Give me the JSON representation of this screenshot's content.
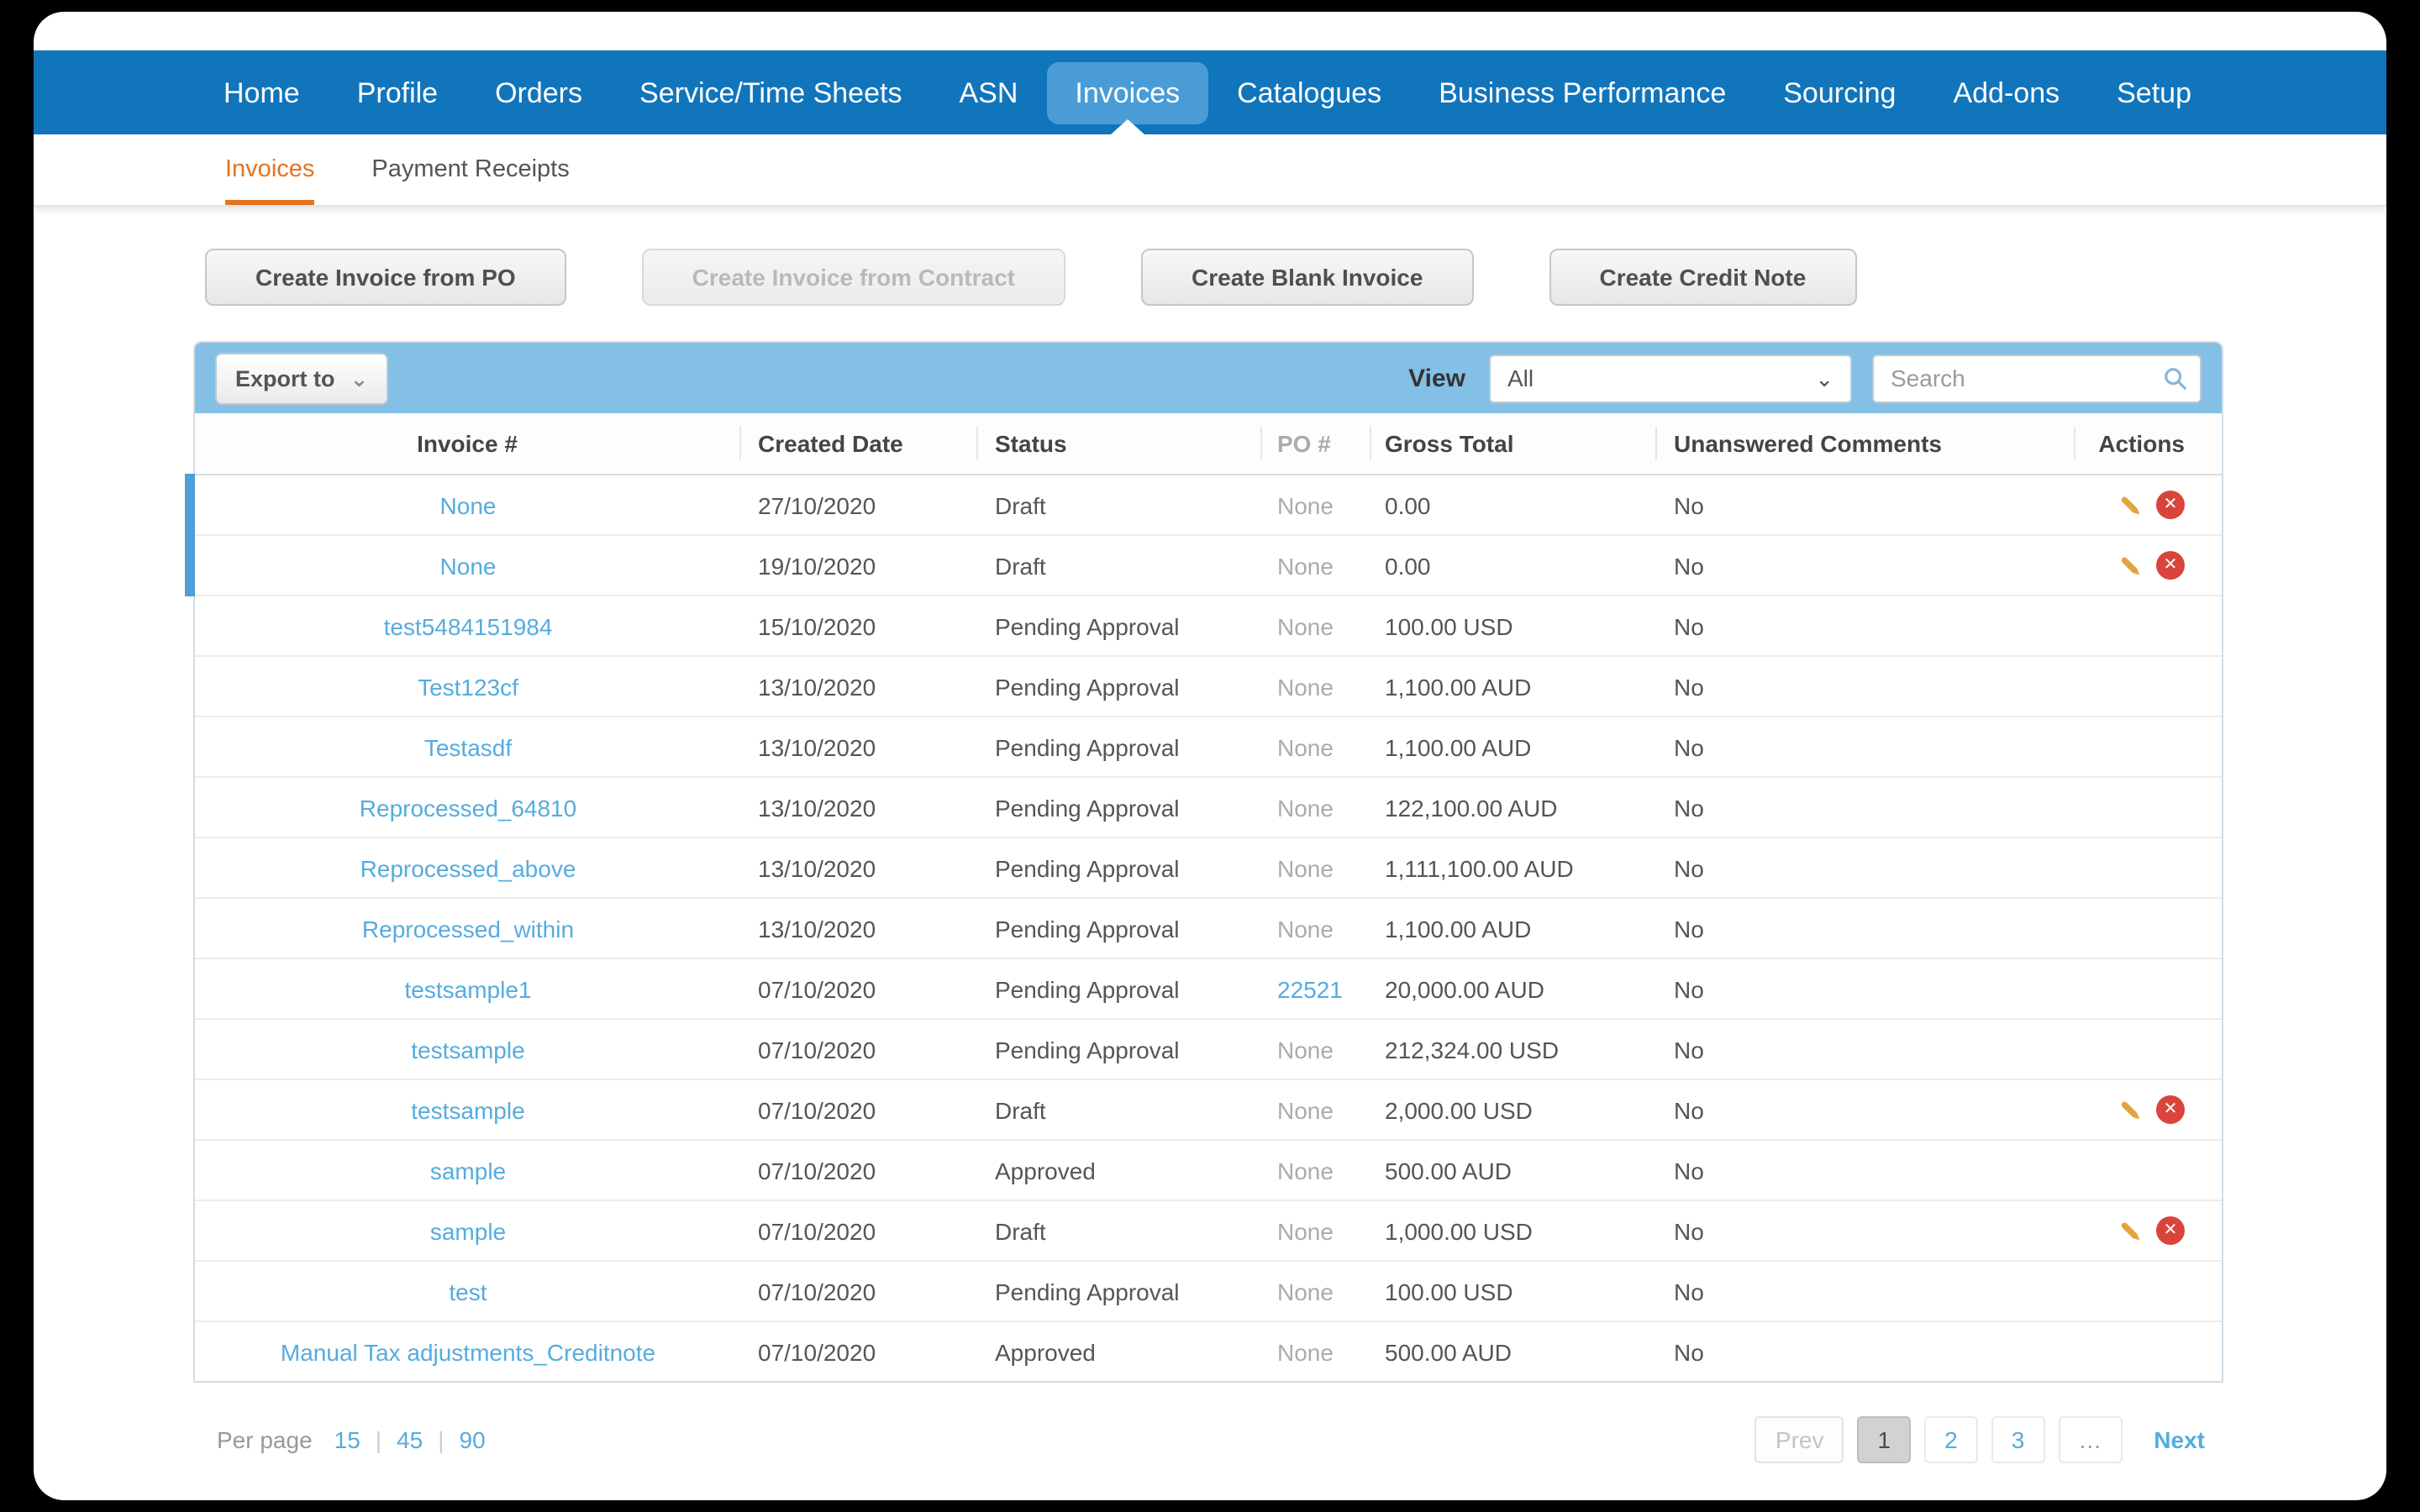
{
  "colors": {
    "nav_blue": "#1175BC",
    "nav_active": "#4A9CD6",
    "orange": "#E5731F",
    "link": "#55ACDE",
    "toolbar_blue": "#84C0E5",
    "accent": "#4D9FD6",
    "red": "#D9443C",
    "pencil": "#E3A43C",
    "text_dark": "#4A4A4A",
    "text_gray": "#ABABAB"
  },
  "icons": {
    "chevron_glyph": "⌄",
    "close_glyph": "✕",
    "search_icon": "magnifier",
    "edit_icon": "pencil",
    "delete_icon": "circle-x",
    "nav_caret": "caret-up"
  },
  "nav": {
    "items": [
      {
        "label": "Home",
        "active": false
      },
      {
        "label": "Profile",
        "active": false
      },
      {
        "label": "Orders",
        "active": false
      },
      {
        "label": "Service/Time Sheets",
        "active": false
      },
      {
        "label": "ASN",
        "active": false
      },
      {
        "label": "Invoices",
        "active": true
      },
      {
        "label": "Catalogues",
        "active": false
      },
      {
        "label": "Business Performance",
        "active": false
      },
      {
        "label": "Sourcing",
        "active": false
      },
      {
        "label": "Add-ons",
        "active": false
      },
      {
        "label": "Setup",
        "active": false
      }
    ]
  },
  "subnav": {
    "items": [
      {
        "label": "Invoices",
        "active": true
      },
      {
        "label": "Payment Receipts",
        "active": false
      }
    ]
  },
  "action_buttons": [
    {
      "label": "Create Invoice from PO",
      "disabled": false
    },
    {
      "label": "Create Invoice from Contract",
      "disabled": true
    },
    {
      "label": "Create Blank Invoice",
      "disabled": false
    },
    {
      "label": "Create Credit Note",
      "disabled": false
    }
  ],
  "toolbar": {
    "export_label": "Export to",
    "view_label": "View",
    "view_value": "All",
    "search_placeholder": "Search"
  },
  "table": {
    "columns": [
      "Invoice #",
      "Created Date",
      "Status",
      "PO #",
      "Gross Total",
      "Unanswered Comments",
      "Actions"
    ],
    "rows": [
      {
        "invoice": "None",
        "created": "27/10/2020",
        "status": "Draft",
        "po": "None",
        "po_is_link": false,
        "gross": "0.00",
        "unanswered_comments": "No",
        "has_actions": true,
        "highlighted": true
      },
      {
        "invoice": "None",
        "created": "19/10/2020",
        "status": "Draft",
        "po": "None",
        "po_is_link": false,
        "gross": "0.00",
        "unanswered_comments": "No",
        "has_actions": true,
        "highlighted": true
      },
      {
        "invoice": "test5484151984",
        "created": "15/10/2020",
        "status": "Pending Approval",
        "po": "None",
        "po_is_link": false,
        "gross": "100.00 USD",
        "unanswered_comments": "No",
        "has_actions": false,
        "highlighted": false
      },
      {
        "invoice": "Test123cf",
        "created": "13/10/2020",
        "status": "Pending Approval",
        "po": "None",
        "po_is_link": false,
        "gross": "1,100.00 AUD",
        "unanswered_comments": "No",
        "has_actions": false,
        "highlighted": false
      },
      {
        "invoice": "Testasdf",
        "created": "13/10/2020",
        "status": "Pending Approval",
        "po": "None",
        "po_is_link": false,
        "gross": "1,100.00 AUD",
        "unanswered_comments": "No",
        "has_actions": false,
        "highlighted": false
      },
      {
        "invoice": "Reprocessed_64810",
        "created": "13/10/2020",
        "status": "Pending Approval",
        "po": "None",
        "po_is_link": false,
        "gross": "122,100.00 AUD",
        "unanswered_comments": "No",
        "has_actions": false,
        "highlighted": false
      },
      {
        "invoice": "Reprocessed_above",
        "created": "13/10/2020",
        "status": "Pending Approval",
        "po": "None",
        "po_is_link": false,
        "gross": "1,111,100.00 AUD",
        "unanswered_comments": "No",
        "has_actions": false,
        "highlighted": false
      },
      {
        "invoice": "Reprocessed_within",
        "created": "13/10/2020",
        "status": "Pending Approval",
        "po": "None",
        "po_is_link": false,
        "gross": "1,100.00 AUD",
        "unanswered_comments": "No",
        "has_actions": false,
        "highlighted": false
      },
      {
        "invoice": "testsample1",
        "created": "07/10/2020",
        "status": "Pending Approval",
        "po": "22521",
        "po_is_link": true,
        "gross": "20,000.00 AUD",
        "unanswered_comments": "No",
        "has_actions": false,
        "highlighted": false
      },
      {
        "invoice": "testsample",
        "created": "07/10/2020",
        "status": "Pending Approval",
        "po": "None",
        "po_is_link": false,
        "gross": "212,324.00 USD",
        "unanswered_comments": "No",
        "has_actions": false,
        "highlighted": false
      },
      {
        "invoice": "testsample",
        "created": "07/10/2020",
        "status": "Draft",
        "po": "None",
        "po_is_link": false,
        "gross": "2,000.00 USD",
        "unanswered_comments": "No",
        "has_actions": true,
        "highlighted": false
      },
      {
        "invoice": "sample",
        "created": "07/10/2020",
        "status": "Approved",
        "po": "None",
        "po_is_link": false,
        "gross": "500.00 AUD",
        "unanswered_comments": "No",
        "has_actions": false,
        "highlighted": false
      },
      {
        "invoice": "sample",
        "created": "07/10/2020",
        "status": "Draft",
        "po": "None",
        "po_is_link": false,
        "gross": "1,000.00 USD",
        "unanswered_comments": "No",
        "has_actions": true,
        "highlighted": false
      },
      {
        "invoice": "test",
        "created": "07/10/2020",
        "status": "Pending Approval",
        "po": "None",
        "po_is_link": false,
        "gross": "100.00 USD",
        "unanswered_comments": "No",
        "has_actions": false,
        "highlighted": false
      },
      {
        "invoice": "Manual Tax adjustments_Creditnote",
        "created": "07/10/2020",
        "status": "Approved",
        "po": "None",
        "po_is_link": false,
        "gross": "500.00 AUD",
        "unanswered_comments": "No",
        "has_actions": false,
        "highlighted": false
      }
    ]
  },
  "footer": {
    "per_page_label": "Per page",
    "per_page_options": [
      "15",
      "45",
      "90"
    ],
    "per_page_separator": "|",
    "pagination": {
      "prev_label": "Prev",
      "pages": [
        "1",
        "2",
        "3"
      ],
      "current": "1",
      "ellipsis": "…",
      "next_label": "Next"
    }
  }
}
